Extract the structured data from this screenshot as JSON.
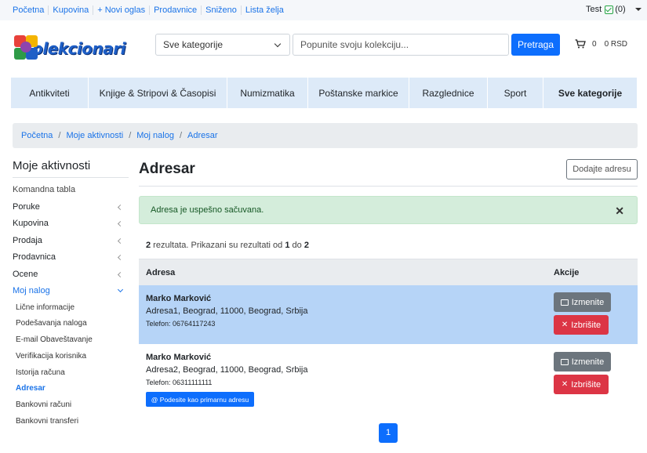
{
  "topbar": {
    "links": [
      "Početna",
      "Kupovina",
      "+ Novi oglas",
      "Prodavnice",
      "Sniženo",
      "Lista želja"
    ],
    "user_name": "Test",
    "notif_count": "(0)"
  },
  "header": {
    "logo_text": "Kolekcionari",
    "category_select": "Sve kategorije",
    "search_placeholder": "Popunite svoju kolekciju...",
    "search_button": "Pretraga",
    "cart_count": "0",
    "cart_total": "0 RSD"
  },
  "catnav": [
    "Antikviteti",
    "Knjige & Stripovi & Časopisi",
    "Numizmatika",
    "Poštanske markice",
    "Razglednice",
    "Sport",
    "Sve kategorije"
  ],
  "breadcrumb": [
    "Početna",
    "Moje aktivnosti",
    "Moj nalog",
    "Adresar"
  ],
  "sidebar": {
    "title": "Moje aktivnosti",
    "items": [
      "Komandna tabla",
      "Poruke",
      "Kupovina",
      "Prodaja",
      "Prodavnica",
      "Ocene",
      "Moj nalog"
    ],
    "subitems": [
      "Lične informacije",
      "Podešavanja naloga",
      "E-mail Obaveštavanje",
      "Verifikacija korisnika",
      "Istorija računa",
      "Adresar",
      "Bankovni računi",
      "Bankovni transferi"
    ]
  },
  "main": {
    "title": "Adresar",
    "add_button": "Dodajte adresu",
    "alert": "Adresa je uspešno sačuvana.",
    "results": {
      "total": "2",
      "text1": " rezultata. Prikazani su rezultati od ",
      "from": "1",
      "text2": " do ",
      "to": "2"
    },
    "columns": [
      "Adresa",
      "Akcije"
    ],
    "rows": [
      {
        "name": "Marko Marković",
        "address": "Adresa1, Beograd, 11000, Beograd, Srbija",
        "phone": "Telefon: 06764117243"
      },
      {
        "name": "Marko Marković",
        "address": "Adresa2, Beograd, 11000, Beograd, Srbija",
        "phone": "Telefon: 06311111111",
        "primary_button": "@ Podesite kao primarnu adresu"
      }
    ],
    "edit_label": "Izmenite",
    "delete_label": "Izbrišite",
    "page": "1"
  },
  "colors": {
    "accent": "#0d6efd",
    "danger": "#dc3545",
    "selected_row": "#b6d4f7",
    "success_bg": "#d4eddb"
  }
}
